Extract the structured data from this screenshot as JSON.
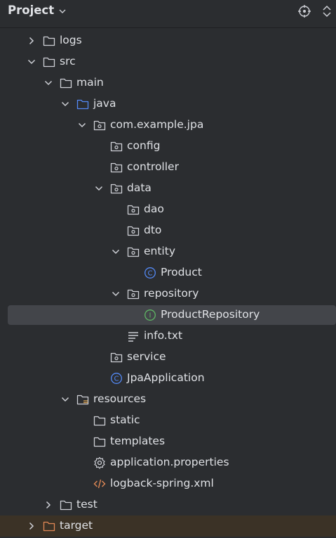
{
  "panel": {
    "title": "Project"
  },
  "colors": {
    "background": "#2b2d30",
    "selection": "#43454a",
    "excluded_row": "#3b3226",
    "folder_gray": "#ced0d6",
    "folder_blue": "#548af7",
    "folder_orange": "#e08855",
    "class_icon": "#548af7",
    "interface_icon": "#5fb865",
    "xml_icon": "#e08855"
  },
  "tree": [
    {
      "label": "logs",
      "icon": "folder-icon",
      "expanded": false
    },
    {
      "label": "src",
      "icon": "folder-icon",
      "expanded": true
    },
    {
      "label": "main",
      "icon": "folder-icon",
      "expanded": true
    },
    {
      "label": "java",
      "icon": "source-folder-icon",
      "expanded": true
    },
    {
      "label": "com.example.jpa",
      "icon": "package-icon",
      "expanded": true
    },
    {
      "label": "config",
      "icon": "package-icon"
    },
    {
      "label": "controller",
      "icon": "package-icon"
    },
    {
      "label": "data",
      "icon": "package-icon",
      "expanded": true
    },
    {
      "label": "dao",
      "icon": "package-icon"
    },
    {
      "label": "dto",
      "icon": "package-icon"
    },
    {
      "label": "entity",
      "icon": "package-icon",
      "expanded": true
    },
    {
      "label": "Product",
      "icon": "class-icon",
      "badge": "C"
    },
    {
      "label": "repository",
      "icon": "package-icon",
      "expanded": true
    },
    {
      "label": "ProductRepository",
      "icon": "interface-icon",
      "badge": "I",
      "selected": true
    },
    {
      "label": "info.txt",
      "icon": "text-file-icon"
    },
    {
      "label": "service",
      "icon": "package-icon"
    },
    {
      "label": "JpaApplication",
      "icon": "class-icon",
      "badge": "C"
    },
    {
      "label": "resources",
      "icon": "resources-folder-icon",
      "expanded": true
    },
    {
      "label": "static",
      "icon": "folder-icon"
    },
    {
      "label": "templates",
      "icon": "folder-icon"
    },
    {
      "label": "application.properties",
      "icon": "gear-icon"
    },
    {
      "label": "logback-spring.xml",
      "icon": "xml-icon"
    },
    {
      "label": "test",
      "icon": "folder-icon",
      "expanded": false
    },
    {
      "label": "target",
      "icon": "excluded-folder-icon",
      "expanded": false
    }
  ]
}
